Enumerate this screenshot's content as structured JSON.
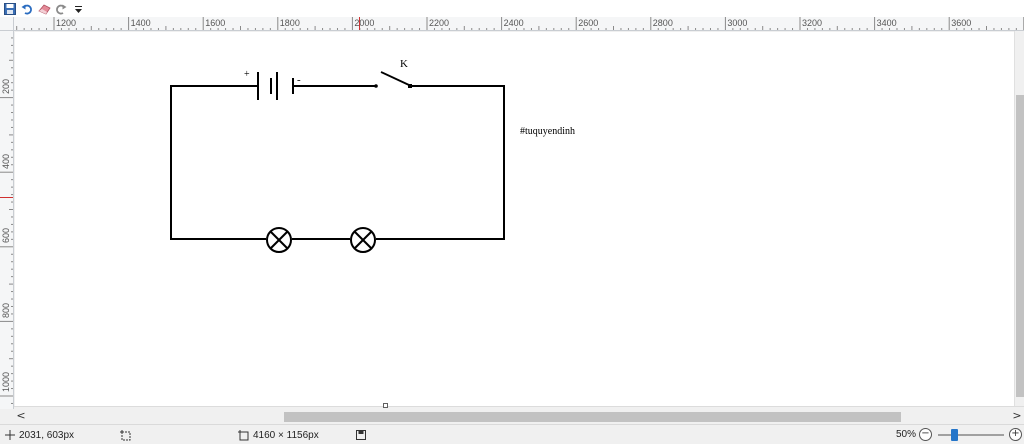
{
  "toolbar": {
    "icons": [
      "save-icon",
      "undo-icon",
      "eraser-icon",
      "redo-icon",
      "customize-dropdown-icon"
    ]
  },
  "ruler": {
    "horizontal_labels": [
      "1200",
      "1400",
      "1600",
      "1800",
      "2000",
      "2200",
      "2400",
      "2600",
      "2800",
      "3000",
      "3200",
      "3400",
      "3600"
    ],
    "vertical_labels": [
      "200",
      "400",
      "600",
      "800",
      "1000"
    ]
  },
  "canvas": {
    "switch_label": "K",
    "battery_plus": "+",
    "battery_minus": "-",
    "watermark": "#tuquyendinh"
  },
  "statusbar": {
    "cursor_position": "2031, 603px",
    "image_size": "4160 × 1156px",
    "zoom_level": "50%",
    "zoom_minus": "−",
    "zoom_plus": "+"
  },
  "colors": {
    "accent": "#2475c9",
    "ruler_marker": "#d03030"
  }
}
